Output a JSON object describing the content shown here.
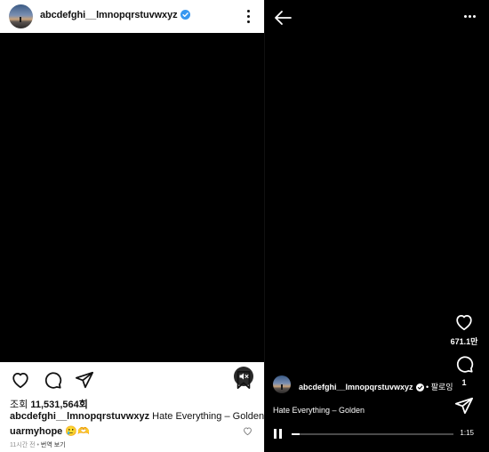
{
  "left_post": {
    "username": "abcdefghi__lmnopqrstuvwxyz",
    "views_label": "조회",
    "views_count": "11,531,564회",
    "caption_user": "abcdefghi__lmnopqrstuvwxyz",
    "caption_text": "Hate Everything – Golden",
    "comment_user": "uarmyhope",
    "comment_text": "🥲🫶",
    "meta_time": "11시간 전",
    "meta_sep": " • ",
    "meta_translate": "번역 보기"
  },
  "right_reel": {
    "username": "abcdefghi__lmnopqrstuvwxyz",
    "follow_label": "팔로잉",
    "follow_sep": " • ",
    "likes_count": "671.1만",
    "comments_count": "1",
    "caption": "Hate Everything – Golden",
    "duration": "1:15",
    "progress": 0.05
  },
  "icons": {
    "verified": "verified-badge-icon",
    "more_vertical": "more-vertical-icon",
    "mute": "volume-mute-icon",
    "like": "heart-icon",
    "comment": "comment-icon",
    "share": "send-icon",
    "save": "bookmark-icon",
    "back": "back-arrow-icon",
    "more_horizontal": "more-horizontal-icon",
    "pause": "pause-icon"
  },
  "colors": {
    "verified_blue": "#3897f0",
    "background_dark": "#000000",
    "background_light": "#ffffff"
  }
}
